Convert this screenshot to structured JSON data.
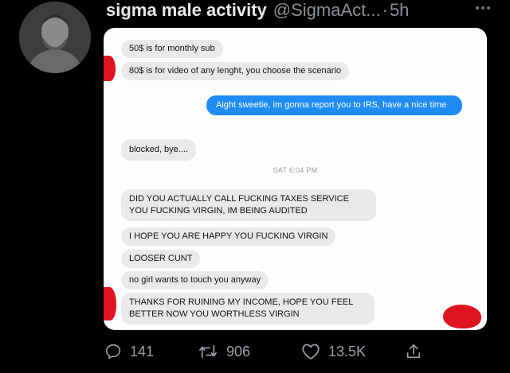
{
  "tweet": {
    "display_name": "sigma male activity",
    "handle": "@SigmaAct...",
    "separator": "·",
    "time": "5h"
  },
  "chat": {
    "messages_top": [
      {
        "text": "50$ is for monthly sub",
        "side": "in"
      },
      {
        "text": "80$ is for video of any lenght, you choose the scenario",
        "side": "in"
      },
      {
        "text": "Aight sweetie, im gonna report you to IRS, have a nice time",
        "side": "out"
      },
      {
        "text": "blocked, bye....",
        "side": "in"
      }
    ],
    "timestamp": "SAT 6:04 PM",
    "messages_bottom": [
      {
        "text": "DID YOU ACTUALLY CALL FUCKING TAXES SERVICE YOU FUCKING VIRGIN, IM BEING AUDITED",
        "side": "in"
      },
      {
        "text": "I HOPE YOU ARE HAPPY YOU FUCKING VIRGIN",
        "side": "in"
      },
      {
        "text": "LOOSER CUNT",
        "side": "in"
      },
      {
        "text": "no girl wants to touch you anyway",
        "side": "in"
      },
      {
        "text": "THANKS FOR RUINING MY INCOME, HOPE YOU FEEL BETTER NOW YOU WORTHLESS VIRGIN",
        "side": "in"
      }
    ],
    "bubble_in_color": "#e9e9eb",
    "bubble_out_color": "#1f8cf3",
    "censor_color": "#e0141e"
  },
  "actions": {
    "reply": {
      "icon": "reply-icon",
      "count": "141"
    },
    "retweet": {
      "icon": "retweet-icon",
      "count": "906"
    },
    "like": {
      "icon": "heart-icon",
      "count": "13.5K"
    },
    "share": {
      "icon": "share-icon"
    }
  }
}
